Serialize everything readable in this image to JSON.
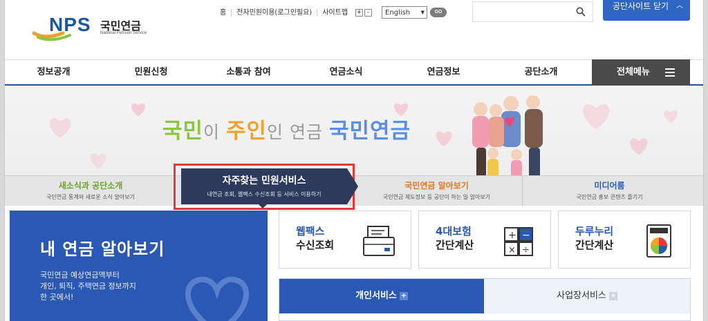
{
  "header": {
    "logo_text": "NPS",
    "logo_korean": "국민연금",
    "logo_english": "National Pension Service",
    "util_links": [
      "홈",
      "전자민원이용(로그인필요)",
      "사이트맵"
    ],
    "font_plus": "+",
    "font_minus": "-",
    "language": "English",
    "go_label": "GO",
    "search_placeholder": "",
    "close_site_label": "공단사이트 닫기"
  },
  "gnb": {
    "items": [
      "정보공개",
      "민원신청",
      "소통과 참여",
      "연금소식",
      "연금정보",
      "공단소개"
    ],
    "all_menu": "전체메뉴"
  },
  "banner": {
    "slogan_1": "국민",
    "slogan_2": "이 ",
    "slogan_3": "주인",
    "slogan_4": "인 연금 ",
    "slogan_5": "국민연금"
  },
  "tabs": [
    {
      "title": "새소식과 공단소개",
      "sub": "국민연금 통계와 새로운 소식 알아보기"
    },
    {
      "title": "자주찾는 민원서비스",
      "sub": "내연금 조회, 웹팩스 수신조회 등 서비스 이용하기"
    },
    {
      "title": "국민연금 알아보기",
      "sub": "국민연금 제도정보 등 공단이 하는 일 알아보기"
    },
    {
      "title": "미디어룸",
      "sub": "국민연금 홍보 콘텐츠 즐기기"
    }
  ],
  "my_pension": {
    "title": "내 연금 알아보기",
    "desc_1": "국민연금 예상연금액부터",
    "desc_2": "개인, 퇴직, 주택연금 정보까지",
    "desc_3": "한 곳에서!"
  },
  "cards": [
    {
      "line1": "웹팩스",
      "line2": "수신조회",
      "icon": "fax-icon"
    },
    {
      "line1": "4대보험",
      "line2": "간단계산",
      "icon": "calculator-icon"
    },
    {
      "line1": "두루누리",
      "line2": "간단계산",
      "icon": "durunuri-calculator-icon"
    }
  ],
  "services": {
    "personal": "개인서비스",
    "business": "사업장서비스",
    "plus": "+"
  },
  "colors": {
    "primary_blue": "#2b58b5",
    "active_tab_navy": "#2d3a5c",
    "highlight_red": "#e53935",
    "green": "#8cc63f",
    "orange": "#e8751a"
  }
}
